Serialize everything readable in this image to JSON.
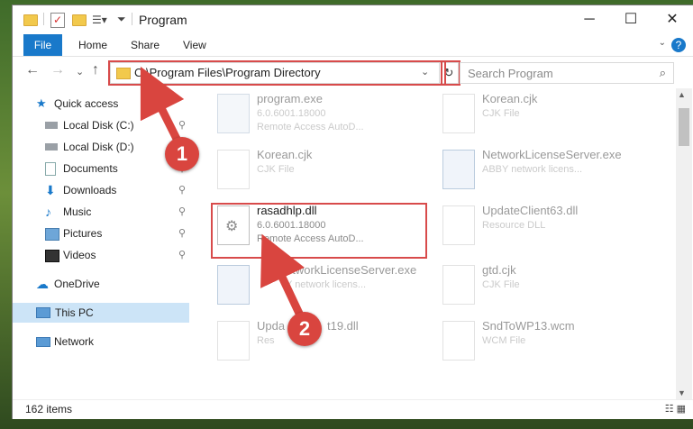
{
  "window": {
    "title": "Program",
    "minimize_glyph": "─",
    "maximize_glyph": "☐",
    "close_glyph": "✕"
  },
  "ribbon": {
    "tabs": [
      "File",
      "Home",
      "Share",
      "View"
    ],
    "help_glyph": "?",
    "expand_glyph": "⌄"
  },
  "nav": {
    "back_glyph": "←",
    "forward_glyph": "→",
    "recent_glyph": "⌄",
    "up_glyph": "↑",
    "address": "C:\\Program Files\\Program Directory",
    "address_drop_glyph": "⌄",
    "refresh_glyph": "↻",
    "search_placeholder": "Search Program",
    "search_glyph": "⌕"
  },
  "sidebar": {
    "items": [
      {
        "label": "Quick access",
        "icon": "star-icon",
        "pinned": false
      },
      {
        "label": "Local Disk (C:)",
        "icon": "drive-icon",
        "pinned": true
      },
      {
        "label": "Local Disk (D:)",
        "icon": "drive-icon",
        "pinned": false
      },
      {
        "label": "Documents",
        "icon": "documents-icon",
        "pinned": true
      },
      {
        "label": "Downloads",
        "icon": "download-icon",
        "pinned": true
      },
      {
        "label": "Music",
        "icon": "music-icon",
        "pinned": true
      },
      {
        "label": "Pictures",
        "icon": "pictures-icon",
        "pinned": true
      },
      {
        "label": "Videos",
        "icon": "videos-icon",
        "pinned": true
      },
      {
        "label": "OneDrive",
        "icon": "cloud-icon",
        "pinned": false
      },
      {
        "label": "This PC",
        "icon": "computer-icon",
        "pinned": false,
        "selected": true
      },
      {
        "label": "Network",
        "icon": "network-icon",
        "pinned": false
      }
    ],
    "pin_glyph": "📌"
  },
  "files": [
    {
      "name": "program.exe",
      "line2": "6.0.6001.18000",
      "line3": "Remote Access AutoD..."
    },
    {
      "name": "Korean.cjk",
      "line2": "CJK File",
      "line3": ""
    },
    {
      "name": "Korean.cjk",
      "line2": "CJK File",
      "line3": ""
    },
    {
      "name": "NetworkLicenseServer.exe",
      "line2": "ABBY network licens...",
      "line3": ""
    },
    {
      "name": "rasadhlp.dll",
      "line2": "6.0.6001.18000",
      "line3": "Remote Access AutoD..."
    },
    {
      "name": "UpdateClient63.dll",
      "line2": "Resource DLL",
      "line3": ""
    },
    {
      "name": "etworkLicenseServer.exe",
      "line2": "Y network licens...",
      "line3": ""
    },
    {
      "name": "gtd.cjk",
      "line2": "CJK File",
      "line3": ""
    },
    {
      "name": "Upda",
      "line2": "Res",
      "line3": ""
    },
    {
      "name": "t19.dll",
      "line2": "",
      "line3": ""
    },
    {
      "name": "SndToWP13.wcm",
      "line2": "WCM File",
      "line3": ""
    }
  ],
  "status": {
    "items_count": "162 items"
  },
  "callouts": {
    "one": "1",
    "two": "2"
  },
  "colors": {
    "accent": "#1979ca",
    "highlight": "#d84b4b",
    "callout": "#d9453f",
    "selected": "#cce4f7"
  }
}
